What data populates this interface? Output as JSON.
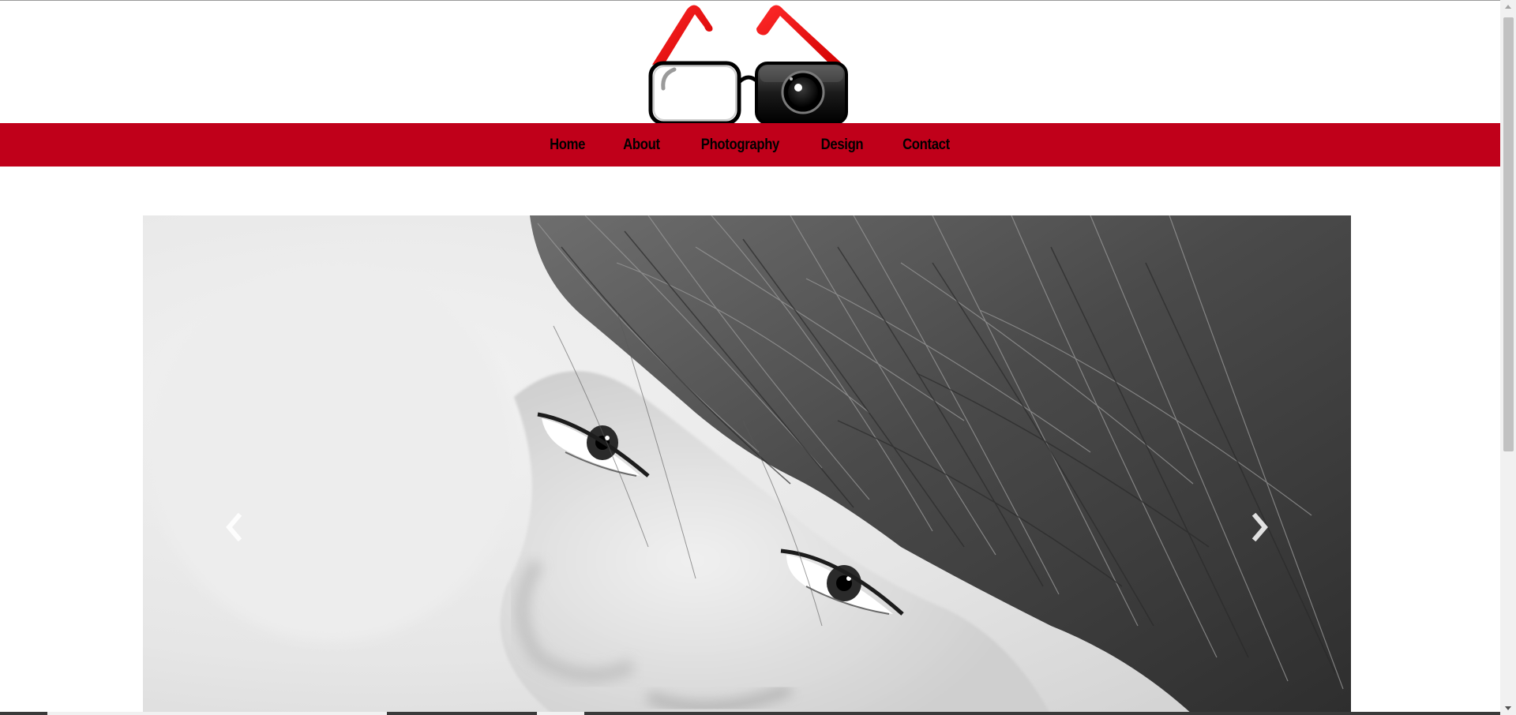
{
  "nav": {
    "items": [
      {
        "label": "Home"
      },
      {
        "label": "About"
      },
      {
        "label": "Photography"
      },
      {
        "label": "Design"
      },
      {
        "label": "Contact"
      }
    ]
  },
  "logo": {
    "icon": "glasses-camera-logo-icon"
  },
  "carousel": {
    "prev_icon": "chevron-left-icon",
    "next_icon": "chevron-right-icon",
    "image": "black-and-white-portrait-photo"
  },
  "colors": {
    "brand_red": "#c0001a",
    "nav_text": "#000000",
    "background": "#ffffff"
  }
}
